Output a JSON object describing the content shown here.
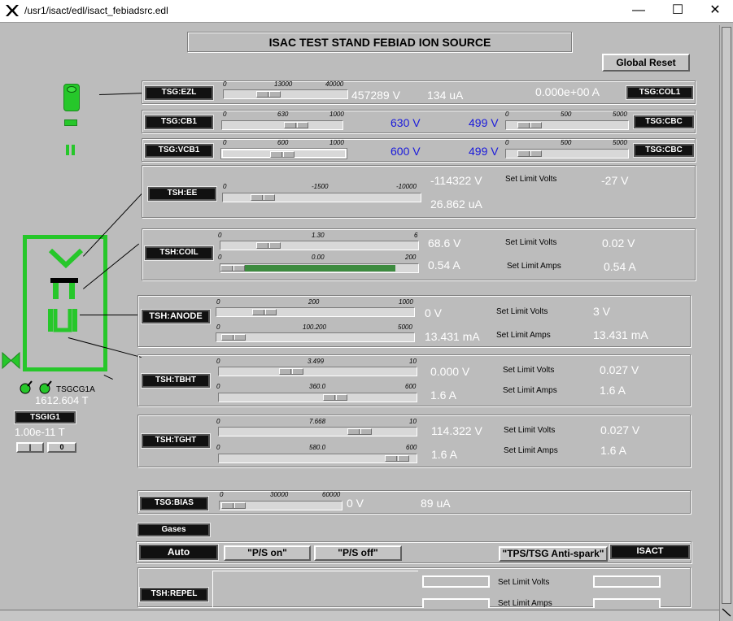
{
  "window": {
    "title": "/usr1/isact/edl/isact_febiadsrc.edl",
    "minimize_glyph": "—",
    "maximize_glyph": "☐",
    "close_glyph": "✕"
  },
  "header": {
    "title": "ISAC TEST STAND FEBIAD ION SOURCE",
    "global_reset": "Global Reset"
  },
  "ezl": {
    "tag": "TSG:EZL",
    "t0": "0",
    "t1": "13000",
    "t2": "40000",
    "volts": "457289 V",
    "current": "134 uA",
    "col_current": "0.000e+00 A",
    "col_tag": "TSG:COL1"
  },
  "cb1": {
    "tag": "TSG:CB1",
    "t0": "0",
    "t1": "630",
    "t2": "1000",
    "v1": "630 V",
    "v2": "499 V",
    "rt0": "0",
    "rt1": "500",
    "rt2": "5000",
    "rtag": "TSG:CBC"
  },
  "vcb1": {
    "tag": "TSG:VCB1",
    "t0": "0",
    "t1": "600",
    "t2": "1000",
    "v1": "600 V",
    "v2": "499 V",
    "rt0": "0",
    "rt1": "500",
    "rt2": "5000",
    "rtag": "TSG:CBC"
  },
  "ee": {
    "tag": "TSH:EE",
    "t0": "0",
    "t1": "-1500",
    "t2": "-10000",
    "volts": "-114322 V",
    "current": "26.862 uA",
    "limit_label": "Set Limit Volts",
    "limit_val": "-27 V"
  },
  "coil": {
    "tag": "TSH:COIL",
    "a0": "0",
    "a1": "1.30",
    "a2": "6",
    "b0": "0",
    "b1": "0.00",
    "b2": "200",
    "volts": "68.6 V",
    "amps": "0.54 A",
    "lv_label": "Set Limit Volts",
    "lv": "0.02 V",
    "la_label": "Set Limit Amps",
    "la": "0.54 A",
    "bar_fraction": 0.87
  },
  "anode": {
    "tag": "TSH:ANODE",
    "a0": "0",
    "a1": "200",
    "a2": "1000",
    "b0": "0",
    "b1": "100.200",
    "b2": "5000",
    "volts": "0 V",
    "current": "13.431 mA",
    "lv_label": "Set Limit Volts",
    "lv": "3 V",
    "la_label": "Set Limit Amps",
    "la": "13.431 mA"
  },
  "tbht": {
    "tag": "TSH:TBHT",
    "a0": "0",
    "a1": "3.499",
    "a2": "10",
    "b0": "0",
    "b1": "360.0",
    "b2": "600",
    "volts": "0.000 V",
    "amps": "1.6 A",
    "lv_label": "Set Limit Volts",
    "lv": "0.027 V",
    "la_label": "Set Limit Amps",
    "la": "1.6 A"
  },
  "tght": {
    "tag": "TSH:TGHT",
    "a0": "0",
    "a1": "7.668",
    "a2": "10",
    "b0": "0",
    "b1": "580.0",
    "b2": "600",
    "volts": "114.322 V",
    "amps": "1.6 A",
    "lv_label": "Set Limit Volts",
    "lv": "0.027 V",
    "la_label": "Set Limit Amps",
    "la": "1.6 A"
  },
  "bias": {
    "tag": "TSG:BIAS",
    "t0": "0",
    "t1": "30000",
    "t2": "60000",
    "volts": "0 V",
    "current": "89 uA"
  },
  "gases": {
    "tag": "Gases"
  },
  "controls": {
    "auto": "Auto",
    "ps_on": "\"P/S on\"",
    "ps_off": "\"P/S off\"",
    "antispark": "\"TPS/TSG Anti-spark\"",
    "isact": "ISACT"
  },
  "repel": {
    "tag": "TSH:REPEL",
    "lv_label": "Set Limit Volts",
    "la_label": "Set Limit Amps"
  },
  "gauges": {
    "cg_name": "TSGCG1A",
    "cg_value": "1612.604 T",
    "ig_tag": "TSGIG1",
    "ig_value": "1.00e-11 T",
    "ig_btn2": "0"
  },
  "colors": {
    "element_green": "#26c72a",
    "value_blue": "#1a1adb",
    "value_white": "#ffffff",
    "panel_gray": "#bcbcbc"
  }
}
